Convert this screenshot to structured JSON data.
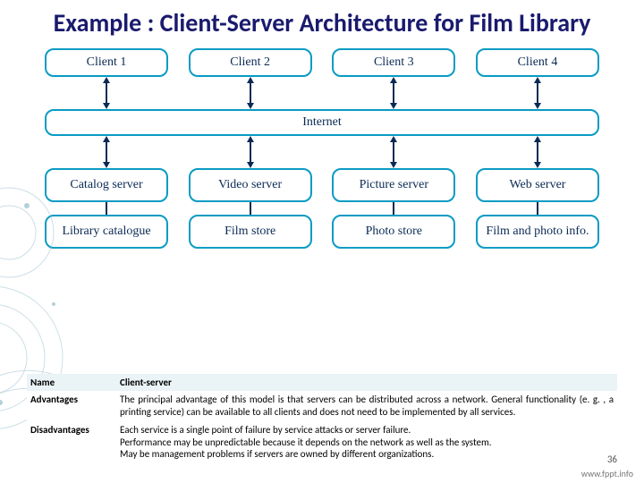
{
  "title": "Example : Client-Server Architecture for Film Library",
  "clients": [
    "Client 1",
    "Client 2",
    "Client 3",
    "Client 4"
  ],
  "internet": "Internet",
  "servers": [
    "Catalog server",
    "Video server",
    "Picture server",
    "Web server"
  ],
  "stores": [
    "Library catalogue",
    "Film store",
    "Photo store",
    "Film and photo info."
  ],
  "table": {
    "rows": [
      {
        "label": "Name",
        "value": "Client-server",
        "bold": true
      },
      {
        "label": "Advantages",
        "value": "The principal advantage of this model is that servers can be distributed across a network. General functionality (e. g. , a printing service) can be available to all clients and does not need to be implemented by all services."
      },
      {
        "label": "Disadvantages",
        "value": "Each service is a single point of failure by service attacks or server failure.\nPerformance may be unpredictable because it depends on the network as well as the system.\nMay be management problems if servers are owned by different organizations."
      }
    ]
  },
  "page_number": "36",
  "footer_link": "www.fppt.info"
}
